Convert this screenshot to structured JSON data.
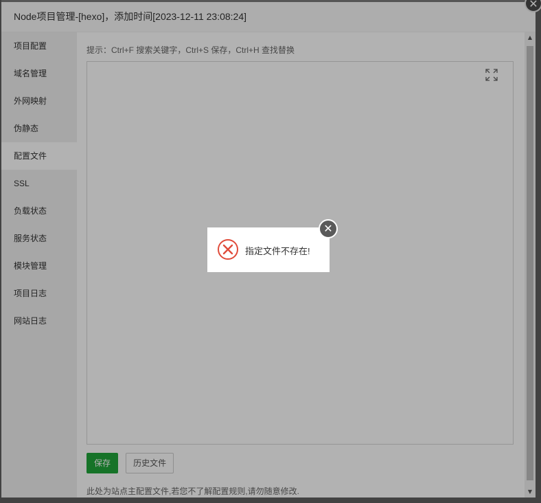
{
  "dialog": {
    "title": "Node项目管理-[hexo]，添加时间[2023-12-11 23:08:24]",
    "close_icon": "close-icon"
  },
  "sidebar": {
    "items": [
      {
        "label": "项目配置"
      },
      {
        "label": "域名管理"
      },
      {
        "label": "外网映射"
      },
      {
        "label": "伪静态"
      },
      {
        "label": "配置文件",
        "active": true
      },
      {
        "label": "SSL"
      },
      {
        "label": "负载状态"
      },
      {
        "label": "服务状态"
      },
      {
        "label": "模块管理"
      },
      {
        "label": "项目日志"
      },
      {
        "label": "网站日志"
      }
    ]
  },
  "main": {
    "hint": "提示：Ctrl+F 搜索关键字，Ctrl+S 保存，Ctrl+H 查找替换",
    "fullscreen_icon": "fullscreen-icon",
    "save_label": "保存",
    "history_label": "历史文件",
    "footnote": "此处为站点主配置文件,若您不了解配置规则,请勿随意修改."
  },
  "toast": {
    "message": "指定文件不存在!",
    "icon": "error-circle-icon",
    "close_icon": "close-icon"
  },
  "colors": {
    "accent": "#20a53a",
    "error": "#e04b3a"
  }
}
